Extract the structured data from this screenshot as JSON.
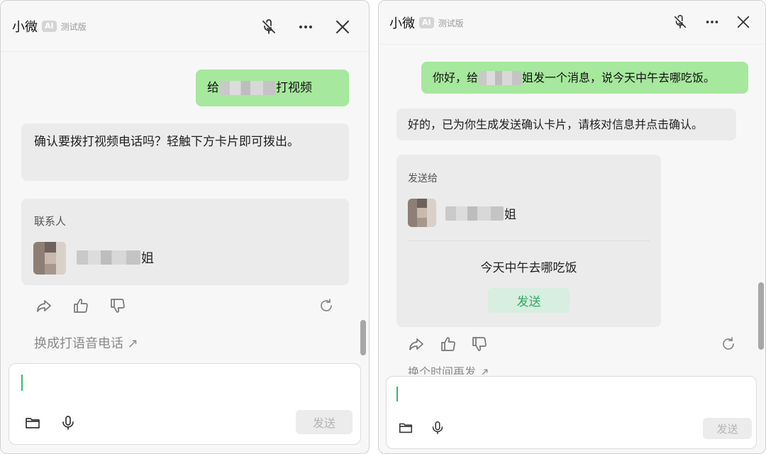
{
  "left": {
    "header": {
      "name": "小微",
      "ai_badge": "AI",
      "beta": "测试版"
    },
    "user_message": {
      "before": "给",
      "after": "打视频"
    },
    "bot_message": "确认要拨打视频电话吗？轻触下方卡片即可拨出。",
    "card": {
      "label": "联系人",
      "contact_suffix": "姐"
    },
    "switch_link": "换成打语音电话 ↗",
    "composer": {
      "send_label": "发送"
    }
  },
  "right": {
    "header": {
      "name": "小微",
      "ai_badge": "AI",
      "beta": "测试版"
    },
    "user_message": {
      "before": "你好，给",
      "after": "姐发一个消息，说今天中午去哪吃饭。"
    },
    "bot_message": "好的，已为你生成发送确认卡片，请核对信息并点击确认。",
    "card": {
      "label": "发送给",
      "contact_suffix": "姐",
      "message": "今天中午去哪吃饭",
      "send_label": "发送"
    },
    "partial_link": "换个时间再发 ↗",
    "composer": {
      "send_label": "发送"
    }
  },
  "colors": {
    "user_bubble": "#a6e89d",
    "bot_bubble": "#ebebeb",
    "accent": "#2faa63",
    "caret": "#3fb66b"
  }
}
